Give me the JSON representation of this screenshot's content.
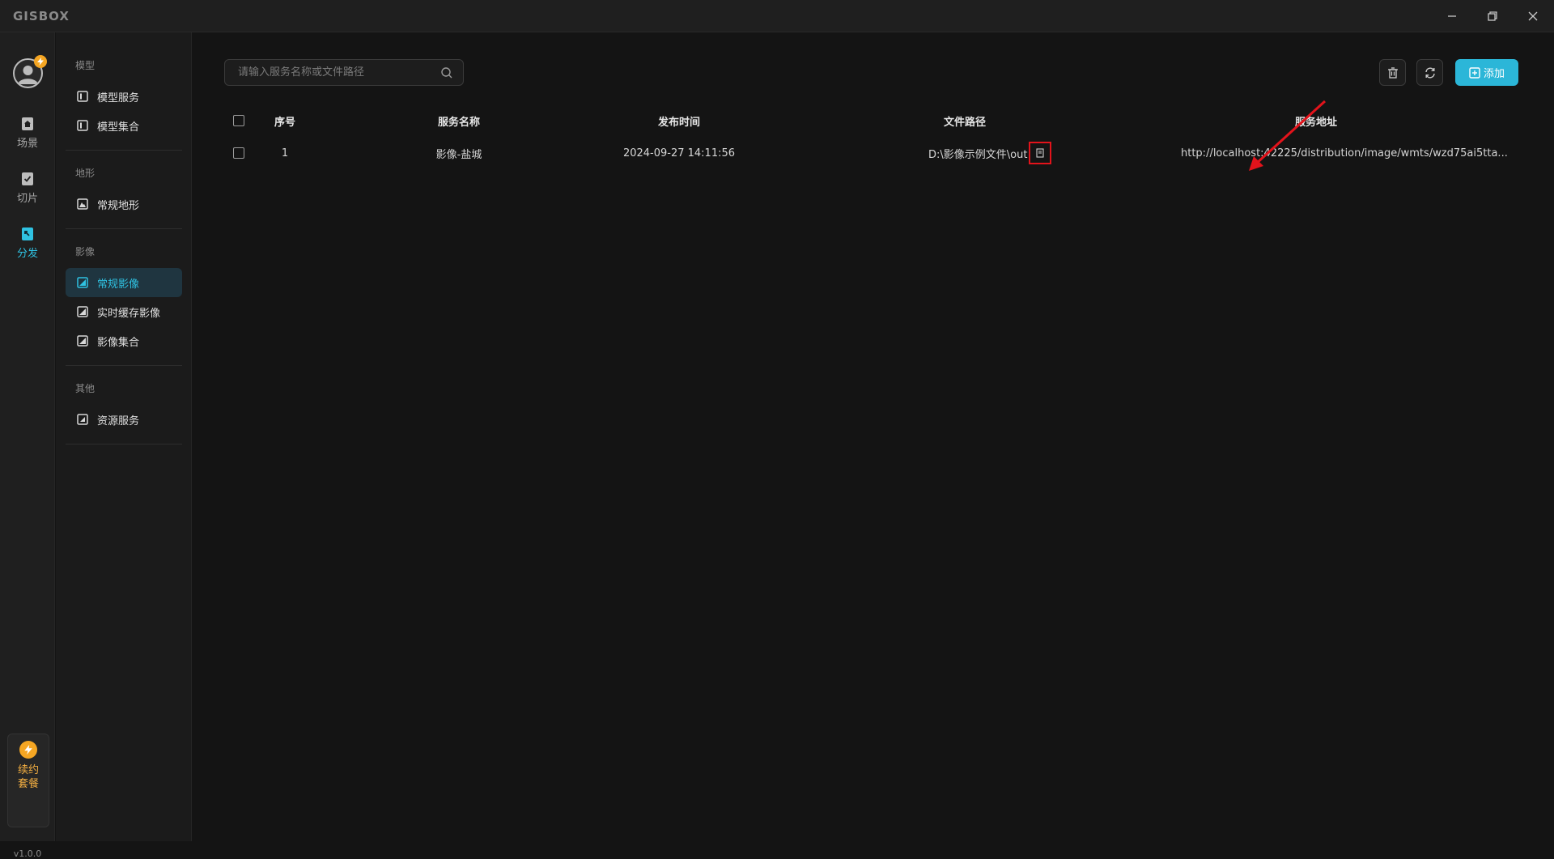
{
  "app": {
    "logo": "GISBOX"
  },
  "window_controls": {
    "minimize_icon": "minimize-icon",
    "restore_icon": "restore-icon",
    "close_icon": "close-icon"
  },
  "leftbar": {
    "items": [
      {
        "label": "场景",
        "icon": "home-icon"
      },
      {
        "label": "切片",
        "icon": "slice-icon"
      },
      {
        "label": "分发",
        "icon": "distribute-icon",
        "active": true
      }
    ],
    "renew": {
      "line1": "续约",
      "line2": "套餐"
    },
    "version": "v1.0.0"
  },
  "subnav": {
    "groups": [
      {
        "title": "模型",
        "items": [
          "模型服务",
          "模型集合"
        ]
      },
      {
        "title": "地形",
        "items": [
          "常规地形"
        ]
      },
      {
        "title": "影像",
        "items": [
          "常规影像",
          "实时缓存影像",
          "影像集合"
        ]
      },
      {
        "title": "其他",
        "items": [
          "资源服务"
        ]
      }
    ],
    "active_item": "常规影像"
  },
  "toolbar": {
    "search_placeholder": "请输入服务名称或文件路径",
    "add_label": "添加"
  },
  "table": {
    "headers": {
      "index": "序号",
      "name": "服务名称",
      "time": "发布时间",
      "path": "文件路径",
      "url": "服务地址"
    },
    "rows": [
      {
        "index": "1",
        "name": "影像-盐城",
        "time": "2024-09-27 14:11:56",
        "path": "D:\\影像示例文件\\out",
        "url": "http://localhost:42225/distribution/image/wmts/wzd75ai5tta..."
      }
    ]
  },
  "colors": {
    "accent": "#2fc2e2",
    "add_button": "#2bb6d8",
    "highlight": "#e3131b",
    "renew": "#f5a623"
  }
}
